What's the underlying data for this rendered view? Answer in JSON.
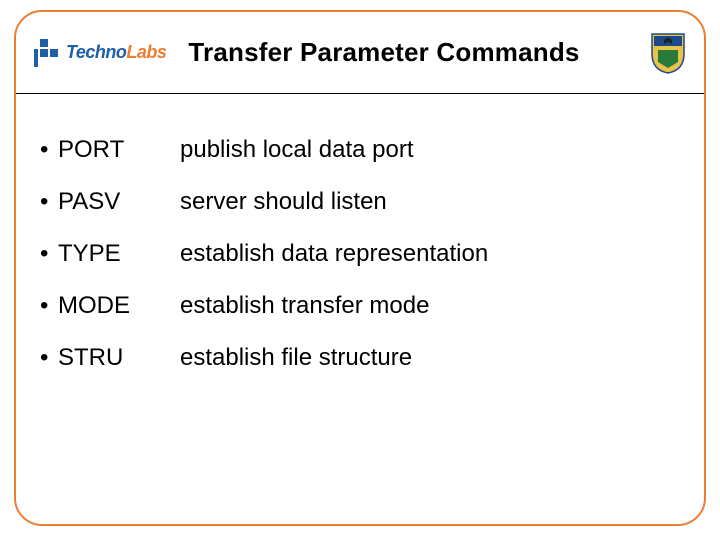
{
  "header": {
    "logo_part1": "Techno",
    "logo_part2": "Labs",
    "title": "Transfer Parameter Commands"
  },
  "commands": [
    {
      "name": "PORT",
      "desc": "publish local data port"
    },
    {
      "name": "PASV",
      "desc": "server should listen"
    },
    {
      "name": "TYPE",
      "desc": "establish data representation"
    },
    {
      "name": "MODE",
      "desc": "establish transfer mode"
    },
    {
      "name": "STRU",
      "desc": "establish file structure"
    }
  ]
}
